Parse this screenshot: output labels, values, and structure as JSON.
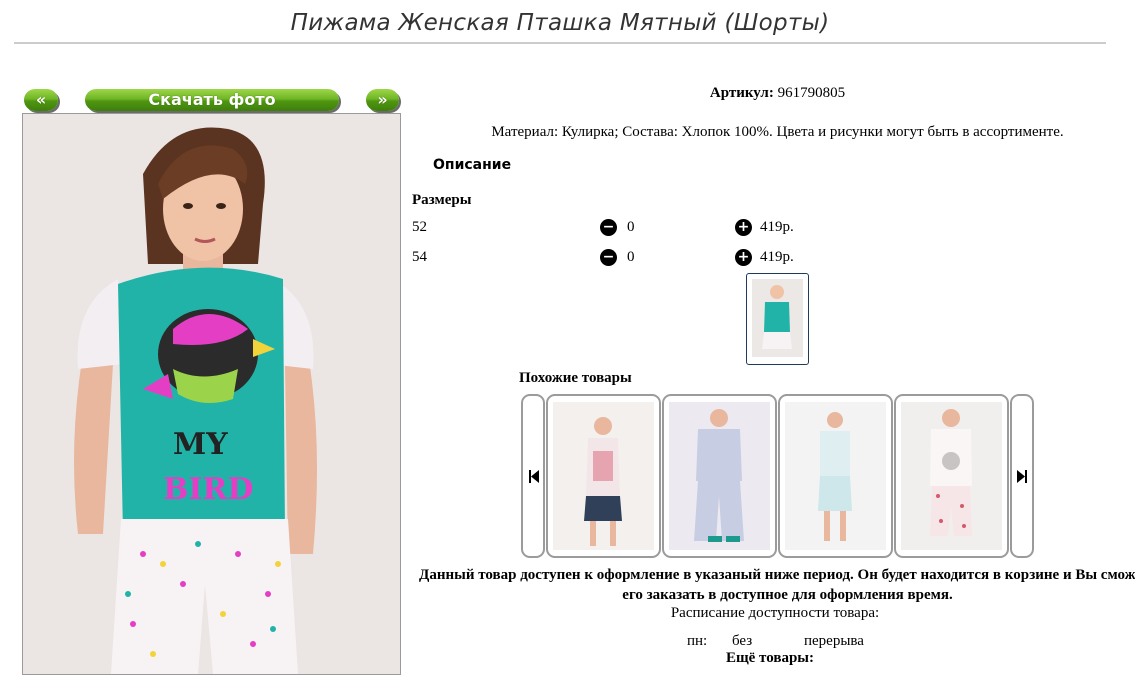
{
  "product": {
    "title": "Пижама Женская Пташка Мятный (Шорты)",
    "article_label": "Артикул:",
    "article_value": "961790805",
    "material_text": "Материал: Кулирка; Состава: Хлопок 100%. Цвета и рисунки могут быть в ассортименте.",
    "description_label": "Описание"
  },
  "photo_nav": {
    "prev_label": "«",
    "download_label": "Скачать фото",
    "next_label": "»"
  },
  "sizes": {
    "heading": "Размеры",
    "rows": [
      {
        "size": "52",
        "qty": "0",
        "price": "419р."
      },
      {
        "size": "54",
        "qty": "0",
        "price": "419р."
      }
    ]
  },
  "similar": {
    "heading": "Похожие товары"
  },
  "availability": {
    "notice": "Данный товар доступен к оформление в указаный ниже период. Он будет находится в корзине и Вы сможете его заказать в доступное для оформления время.",
    "schedule_label": "Расписание доступности товара:",
    "day": "пн:",
    "from": "без",
    "to": "перерыва"
  },
  "more": {
    "heading": "Ещё товары:"
  },
  "colors": {
    "button_green": "#6fb624",
    "shirt_mint": "#22b3a8",
    "bird_pink": "#e43fc4"
  }
}
